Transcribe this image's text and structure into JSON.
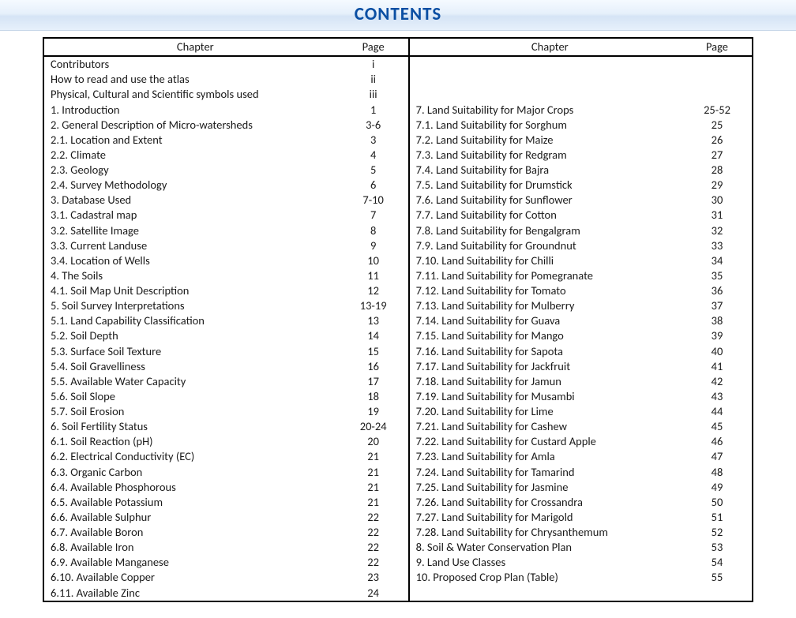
{
  "title": "CONTENTS",
  "headers": {
    "chapter": "Chapter",
    "page": "Page"
  },
  "left": [
    {
      "t": "Contributors",
      "p": "i",
      "lvl": 1
    },
    {
      "t": "How to read and use the atlas",
      "p": "ii",
      "lvl": 1
    },
    {
      "t": "Physical, Cultural and Scientific symbols used",
      "p": "iii",
      "lvl": 1
    },
    {
      "t": "1. Introduction",
      "p": "1",
      "lvl": 0
    },
    {
      "t": "2. General Description of Micro-watersheds",
      "p": "3-6",
      "lvl": 0
    },
    {
      "t": "2.1. Location and Extent",
      "p": "3",
      "lvl": 2
    },
    {
      "t": "2.2. Climate",
      "p": "4",
      "lvl": 2
    },
    {
      "t": "2.3. Geology",
      "p": "5",
      "lvl": 2
    },
    {
      "t": "2.4. Survey Methodology",
      "p": "6",
      "lvl": 2
    },
    {
      "t": "3. Database Used",
      "p": "7-10",
      "lvl": 0
    },
    {
      "t": "3.1. Cadastral map",
      "p": "7",
      "lvl": 2
    },
    {
      "t": "3.2. Satellite Image",
      "p": "8",
      "lvl": 2
    },
    {
      "t": "3.3. Current Landuse",
      "p": "9",
      "lvl": 2
    },
    {
      "t": "3.4. Location of Wells",
      "p": "10",
      "lvl": 2
    },
    {
      "t": "4. The Soils",
      "p": "11",
      "lvl": 0
    },
    {
      "t": "4.1. Soil Map Unit Description",
      "p": "12",
      "lvl": 2
    },
    {
      "t": "5. Soil Survey Interpretations",
      "p": "13-19",
      "lvl": 0
    },
    {
      "t": "5.1. Land Capability Classification",
      "p": "13",
      "lvl": 2
    },
    {
      "t": "5.2. Soil Depth",
      "p": "14",
      "lvl": 2
    },
    {
      "t": "5.3. Surface Soil Texture",
      "p": "15",
      "lvl": 2
    },
    {
      "t": "5.4. Soil Gravelliness",
      "p": "16",
      "lvl": 2
    },
    {
      "t": "5.5. Available Water Capacity",
      "p": "17",
      "lvl": 2
    },
    {
      "t": "5.6. Soil Slope",
      "p": "18",
      "lvl": 2
    },
    {
      "t": "5.7. Soil Erosion",
      "p": "19",
      "lvl": 2
    },
    {
      "t": "6. Soil Fertility Status",
      "p": "20-24",
      "lvl": 0
    },
    {
      "t": "6.1. Soil Reaction (pH)",
      "p": "20",
      "lvl": 2
    },
    {
      "t": "6.2. Electrical Conductivity (EC)",
      "p": "21",
      "lvl": 2
    },
    {
      "t": "6.3. Organic Carbon",
      "p": "21",
      "lvl": 2
    },
    {
      "t": "6.4. Available  Phosphorous",
      "p": "21",
      "lvl": 2
    },
    {
      "t": "6.5. Available  Potassium",
      "p": "21",
      "lvl": 2
    },
    {
      "t": "6.6. Available Sulphur",
      "p": "22",
      "lvl": 2
    },
    {
      "t": "6.7. Available Boron",
      "p": "22",
      "lvl": 2
    },
    {
      "t": "6.8. Available Iron",
      "p": "22",
      "lvl": 2
    },
    {
      "t": "6.9. Available Manganese",
      "p": "22",
      "lvl": 2
    },
    {
      "t": "6.10. Available Copper",
      "p": "23",
      "lvl": 2
    },
    {
      "t": "6.11. Available Zinc",
      "p": "24",
      "lvl": 2
    }
  ],
  "right": [
    {
      "t": "",
      "p": "",
      "lvl": 0
    },
    {
      "t": "",
      "p": "",
      "lvl": 0
    },
    {
      "t": "",
      "p": "",
      "lvl": 0
    },
    {
      "t": "7. Land Suitability for Major Crops",
      "p": "25-52",
      "lvl": 0
    },
    {
      "t": "7.1. Land Suitability for Sorghum",
      "p": "25",
      "lvl": 2
    },
    {
      "t": "7.2. Land Suitability for Maize",
      "p": "26",
      "lvl": 2
    },
    {
      "t": "7.3. Land Suitability for Redgram",
      "p": "27",
      "lvl": 2
    },
    {
      "t": "7.4. Land Suitability for Bajra",
      "p": "28",
      "lvl": 2
    },
    {
      "t": "7.5. Land Suitability for Drumstick",
      "p": "29",
      "lvl": 2
    },
    {
      "t": "7.6. Land Suitability for Sunflower",
      "p": "30",
      "lvl": 2
    },
    {
      "t": "7.7. Land Suitability for Cotton",
      "p": "31",
      "lvl": 2
    },
    {
      "t": "7.8. Land Suitability for Bengalgram",
      "p": "32",
      "lvl": 2
    },
    {
      "t": "7.9. Land Suitability for Groundnut",
      "p": "33",
      "lvl": 2
    },
    {
      "t": "7.10. Land Suitability for Chilli",
      "p": "34",
      "lvl": 2
    },
    {
      "t": "7.11. Land Suitability for Pomegranate",
      "p": "35",
      "lvl": 2
    },
    {
      "t": "7.12. Land Suitability for Tomato",
      "p": "36",
      "lvl": 2
    },
    {
      "t": "7.13. Land Suitability for Mulberry",
      "p": "37",
      "lvl": 2
    },
    {
      "t": "7.14. Land Suitability for Guava",
      "p": "38",
      "lvl": 2
    },
    {
      "t": "7.15. Land Suitability for Mango",
      "p": "39",
      "lvl": 2
    },
    {
      "t": "7.16. Land Suitability for Sapota",
      "p": "40",
      "lvl": 2
    },
    {
      "t": "7.17. Land Suitability for Jackfruit",
      "p": "41",
      "lvl": 2
    },
    {
      "t": "7.18. Land Suitability for Jamun",
      "p": "42",
      "lvl": 2
    },
    {
      "t": "7.19. Land Suitability for Musambi",
      "p": "43",
      "lvl": 2
    },
    {
      "t": "7.20. Land Suitability for Lime",
      "p": "44",
      "lvl": 2
    },
    {
      "t": "7.21. Land Suitability for Cashew",
      "p": "45",
      "lvl": 2
    },
    {
      "t": "7.22. Land Suitability for Custard Apple",
      "p": "46",
      "lvl": 2
    },
    {
      "t": "7.23. Land Suitability for Amla",
      "p": "47",
      "lvl": 2
    },
    {
      "t": "7.24. Land Suitability for Tamarind",
      "p": "48",
      "lvl": 2
    },
    {
      "t": "7.25. Land Suitability for Jasmine",
      "p": "49",
      "lvl": 2
    },
    {
      "t": "7.26. Land Suitability for Crossandra",
      "p": "50",
      "lvl": 2
    },
    {
      "t": "7.27. Land Suitability for Marigold",
      "p": "51",
      "lvl": 2
    },
    {
      "t": "7.28. Land Suitability for Chrysanthemum",
      "p": "52",
      "lvl": 2
    },
    {
      "t": "8. Soil & Water Conservation Plan",
      "p": "53",
      "lvl": 0
    },
    {
      "t": "9. Land Use Classes",
      "p": "54",
      "lvl": 0
    },
    {
      "t": "10. Proposed Crop Plan (Table)",
      "p": "55",
      "lvl": 0
    }
  ]
}
